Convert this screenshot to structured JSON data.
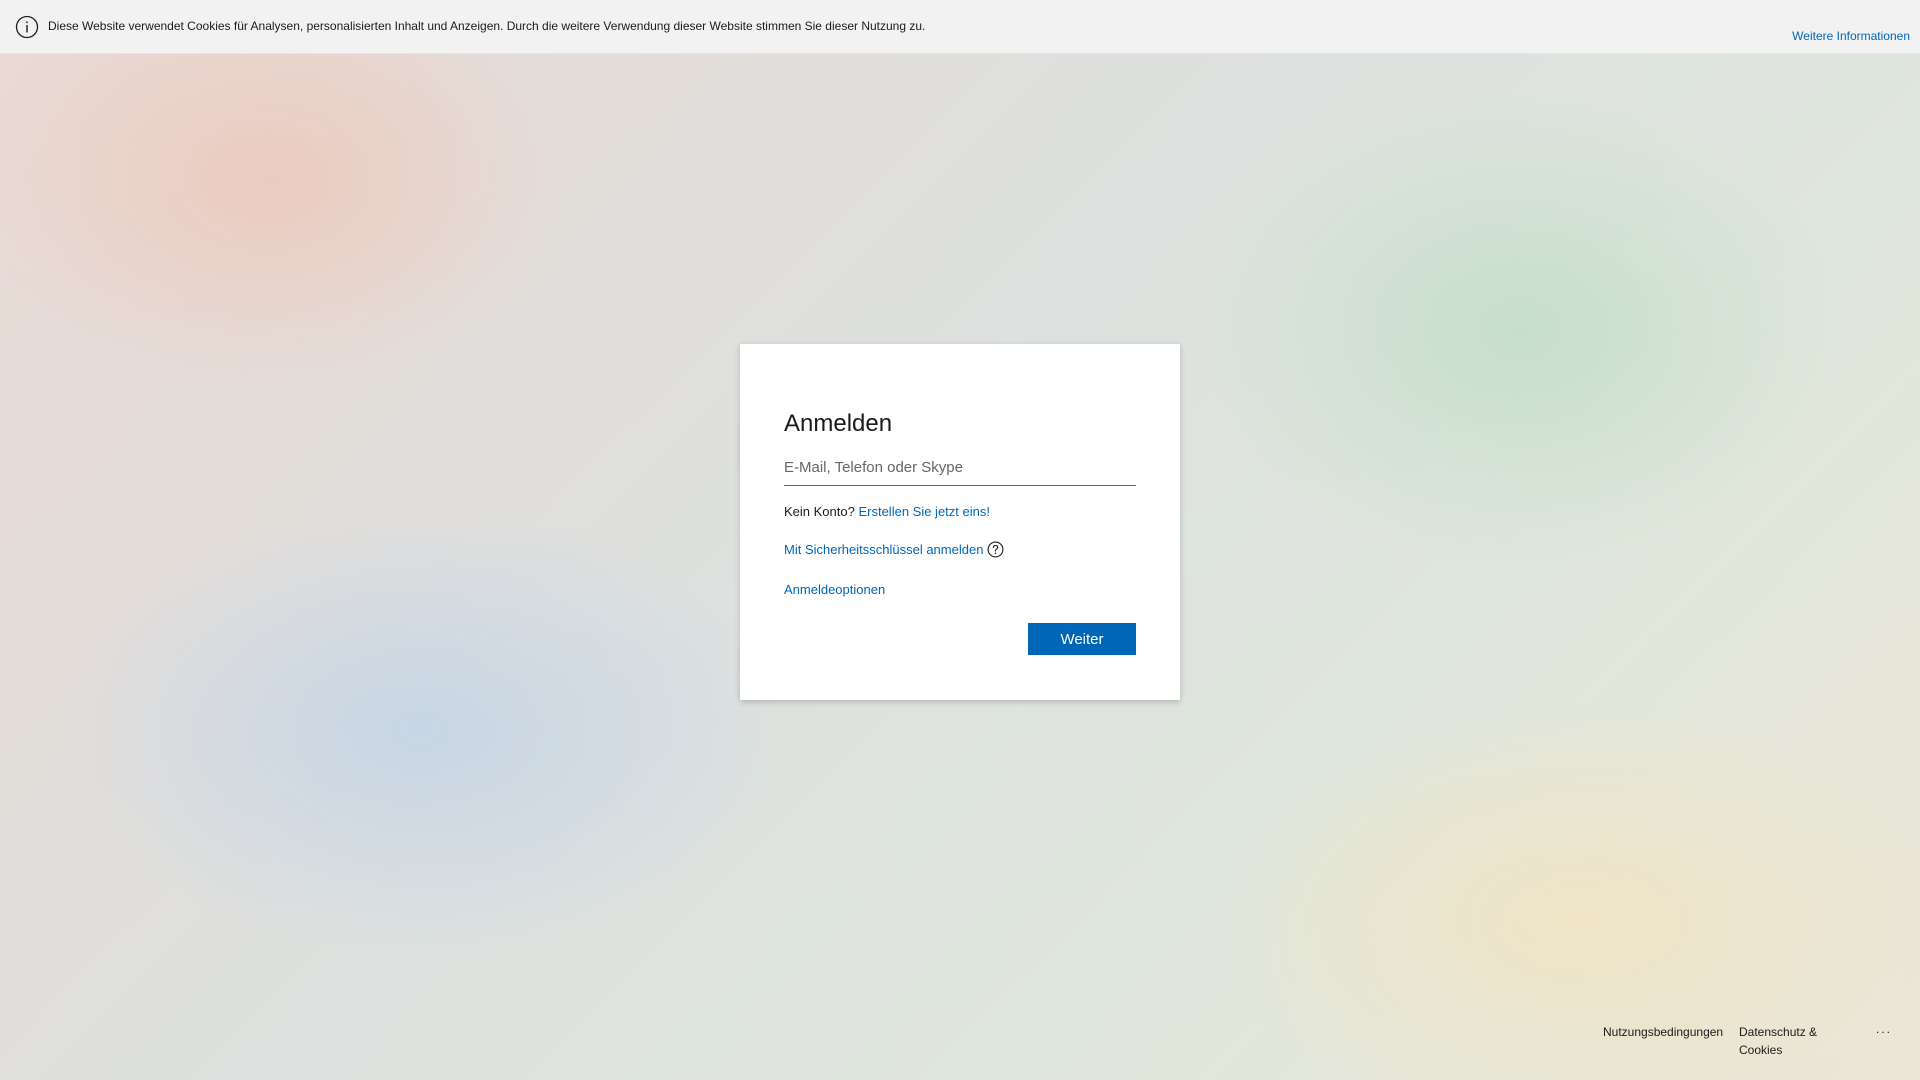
{
  "cookie_banner": {
    "icon": "info-icon",
    "text": "Diese Website verwendet Cookies für Analysen, personalisierten Inhalt und Anzeigen. Durch die weitere Verwendung dieser Website stimmen Sie dieser Nutzung zu.",
    "more_info_label": "Weitere Informationen"
  },
  "signin": {
    "title": "Anmelden",
    "email_placeholder": "E-Mail, Telefon oder Skype",
    "email_value": "",
    "no_account_text": "Kein Konto?",
    "create_account_label": "Erstellen Sie jetzt eins!",
    "security_key_label": "Mit Sicherheitsschlüssel anmelden",
    "security_key_icon": "help-circle-icon",
    "signin_options_label": "Anmeldeoptionen",
    "next_button_label": "Weiter"
  },
  "footer": {
    "terms_label": "Nutzungsbedingungen",
    "privacy_label": "Datenschutz & Cookies",
    "more_label": "..."
  },
  "colors": {
    "accent": "#0067b8",
    "banner_background": "#f2f2f2",
    "text": "#1b1b1b"
  }
}
